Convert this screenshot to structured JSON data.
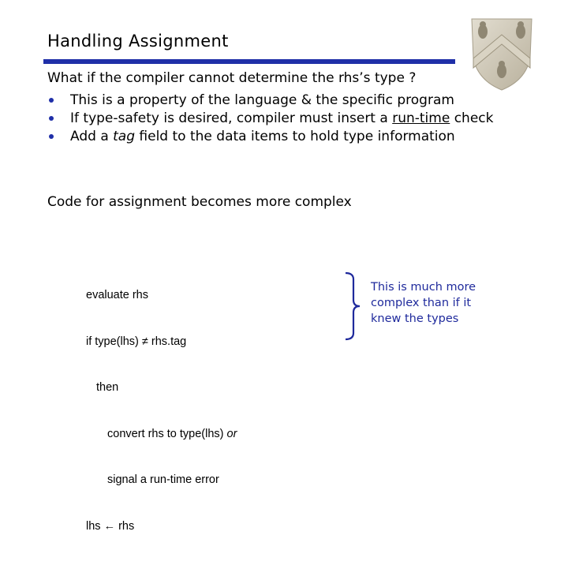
{
  "slide": {
    "title": "Handling Assignment",
    "intro": "What if the compiler cannot determine the rhs’s type ?",
    "bullets": [
      {
        "text": "This is a property of the language & the specific program"
      },
      {
        "before": "If type-safety is desired, compiler must insert a ",
        "emph": "run-time",
        "after": " check"
      },
      {
        "before": "Add a ",
        "emph": "tag",
        "after": "  field to the data items to hold type information"
      }
    ],
    "subheading": "Code for assignment becomes more complex",
    "code": {
      "line1": "evaluate rhs",
      "line2_a": "if type(lhs) ",
      "line2_op": "≠",
      "line2_b": " rhs.tag",
      "line3": "then",
      "line4_a": "convert rhs to type(lhs) ",
      "line4_or": "or",
      "line5": "signal a run-time error",
      "line6_a": "lhs ",
      "line6_arrow": "←",
      "line6_b": " rhs"
    },
    "note": {
      "line1": "This is much more",
      "line2": "complex than if it",
      "line3": "knew the types"
    }
  },
  "logo": {
    "icon": "university-crest-icon",
    "description": "shield with three owls and chevron"
  },
  "colors": {
    "accent": "#1f2fa8",
    "note_text": "#1f2a9c",
    "crest": "#cfc8b6"
  }
}
